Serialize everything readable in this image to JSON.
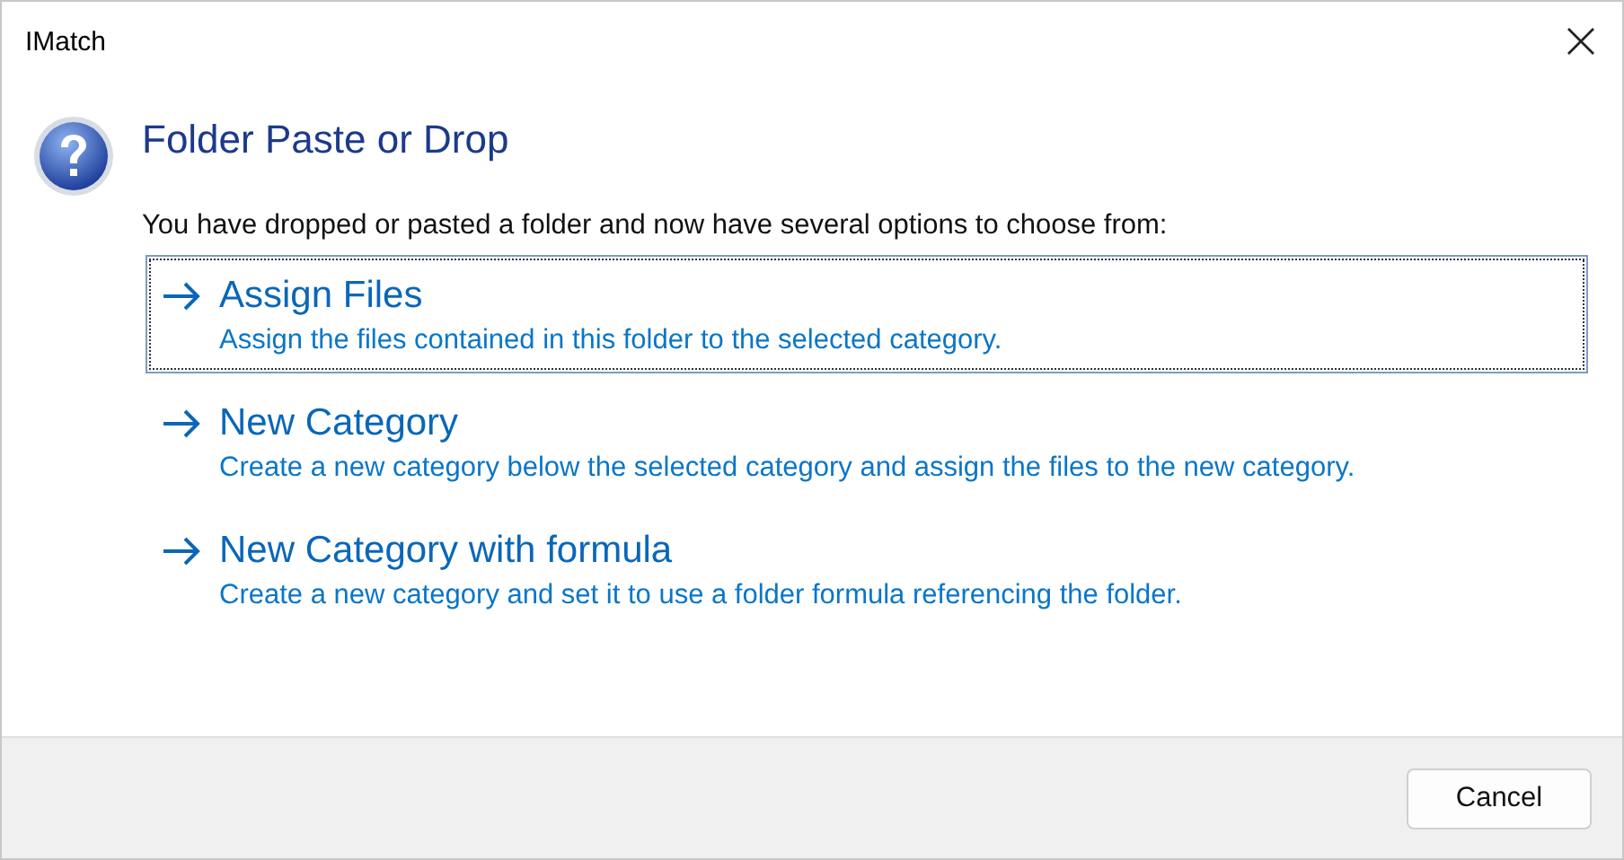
{
  "window": {
    "title": "IMatch"
  },
  "heading": "Folder Paste or Drop",
  "intro": "You have dropped or pasted a folder and now have several options to choose from:",
  "options": [
    {
      "title": "Assign Files",
      "description": "Assign the files contained in this folder to the selected category.",
      "selected": true
    },
    {
      "title": "New Category",
      "description": "Create a new category below the selected category and assign the files to the new category.",
      "selected": false
    },
    {
      "title": "New Category with formula",
      "description": "Create a new category and set it to use a folder formula referencing the folder.",
      "selected": false
    }
  ],
  "buttons": [
    {
      "label": "Cancel"
    }
  ]
}
